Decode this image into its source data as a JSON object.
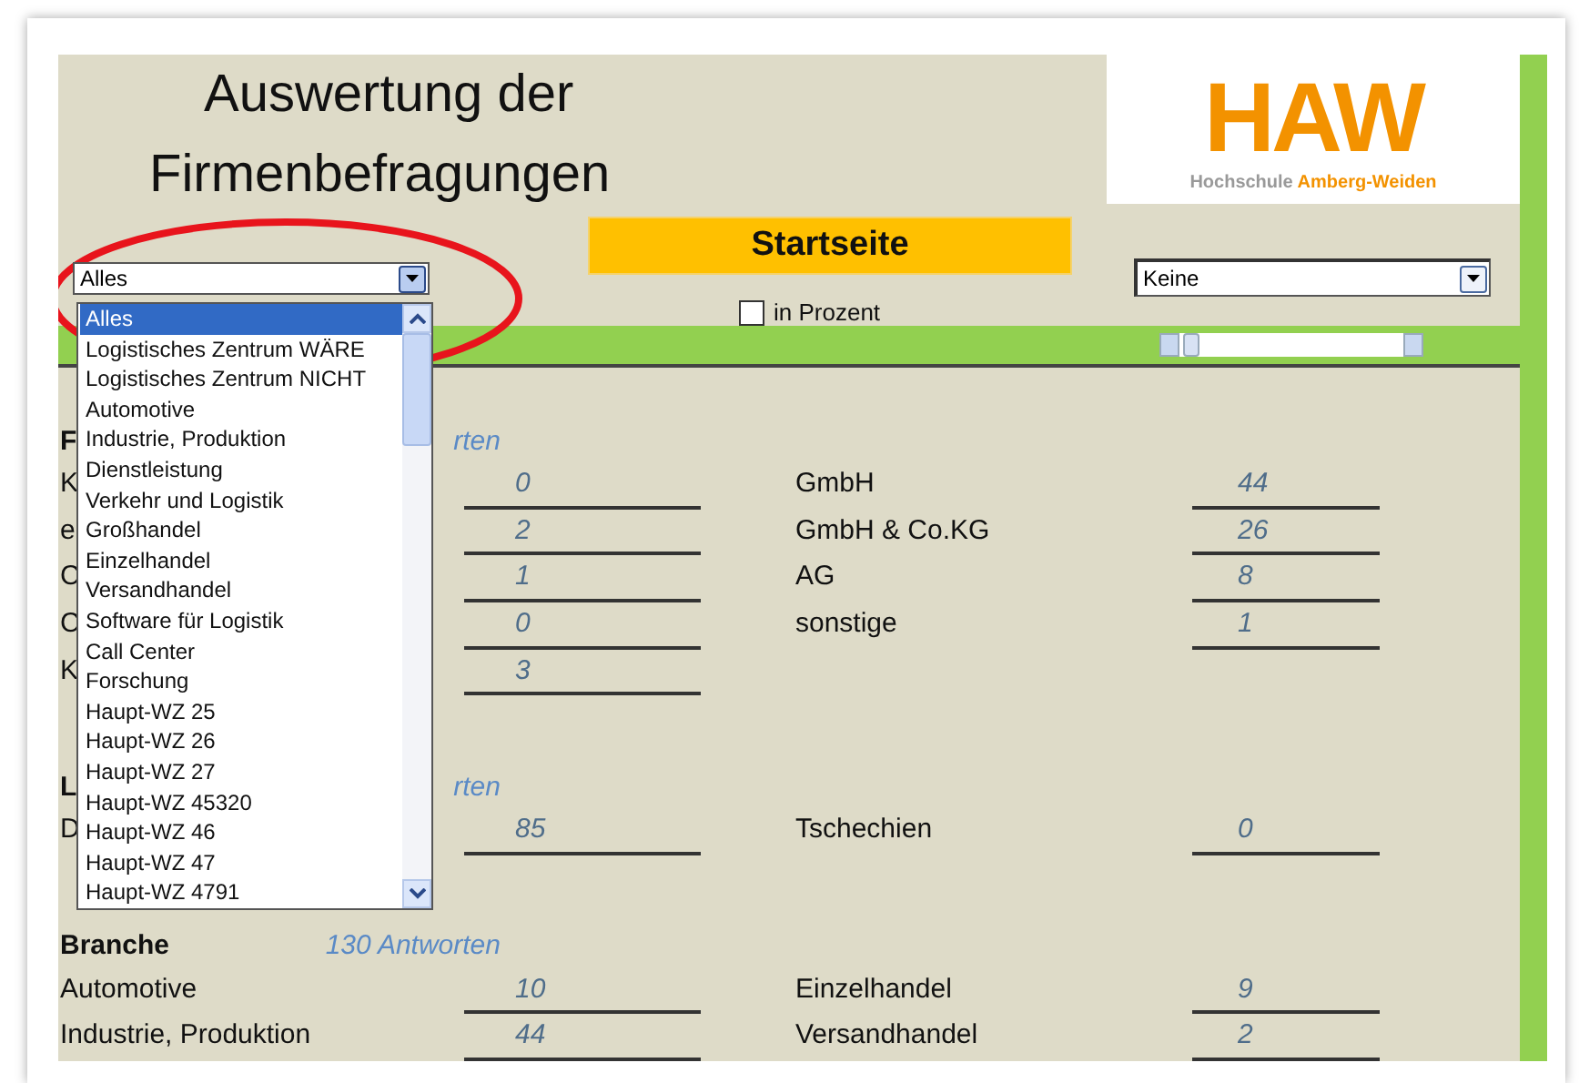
{
  "title_lines": [
    "Auswertung der",
    "Firmenbefragungen"
  ],
  "logo": {
    "wordmark": "HAW",
    "caption": [
      "Hochschule",
      "Amberg-Weiden"
    ]
  },
  "filter_dropdown": {
    "value": "Alles",
    "expanded": true,
    "options": [
      {
        "label": "Alles",
        "selected": true
      },
      {
        "label": "Logistisches Zentrum WÄRE",
        "selected": false
      },
      {
        "label": "Logistisches Zentrum NICHT",
        "selected": false
      },
      {
        "label": "Automotive",
        "selected": false
      },
      {
        "label": "Industrie, Produktion",
        "selected": false
      },
      {
        "label": "Dienstleistung",
        "selected": false
      },
      {
        "label": "Verkehr und Logistik",
        "selected": false
      },
      {
        "label": "Großhandel",
        "selected": false
      },
      {
        "label": "Einzelhandel",
        "selected": false
      },
      {
        "label": "Versandhandel",
        "selected": false
      },
      {
        "label": "Software für Logistik",
        "selected": false
      },
      {
        "label": "Call Center",
        "selected": false
      },
      {
        "label": "Forschung",
        "selected": false
      },
      {
        "label": "Haupt-WZ 25",
        "selected": false
      },
      {
        "label": "Haupt-WZ 26",
        "selected": false
      },
      {
        "label": "Haupt-WZ 27",
        "selected": false
      },
      {
        "label": "Haupt-WZ 45320",
        "selected": false
      },
      {
        "label": "Haupt-WZ 46",
        "selected": false
      },
      {
        "label": "Haupt-WZ 47",
        "selected": false
      },
      {
        "label": "Haupt-WZ 4791",
        "selected": false
      }
    ]
  },
  "start_button": "Startseite",
  "percent_checkbox": {
    "label": "in Prozent",
    "checked": false
  },
  "second_dropdown": {
    "value": "Keine"
  },
  "sections": [
    {
      "heading": "F",
      "count": "rten",
      "rows": [
        {
          "left": {
            "label": "K",
            "value": "0"
          },
          "right": {
            "label": "GmbH",
            "value": "44"
          }
        },
        {
          "left": {
            "label": "e",
            "value": "2"
          },
          "right": {
            "label": "GmbH & Co.KG",
            "value": "26"
          }
        },
        {
          "left": {
            "label": "C",
            "value": "1"
          },
          "right": {
            "label": "AG",
            "value": "8"
          }
        },
        {
          "left": {
            "label": "C",
            "value": "0"
          },
          "right": {
            "label": "sonstige",
            "value": "1"
          }
        },
        {
          "left": {
            "label": "K",
            "value": "3"
          }
        }
      ]
    },
    {
      "heading": "L",
      "count": "rten",
      "rows": [
        {
          "left": {
            "label": "D",
            "value": "85"
          },
          "right": {
            "label": "Tschechien",
            "value": "0"
          }
        }
      ]
    },
    {
      "heading": "Branche",
      "count": "130 Antworten",
      "rows": [
        {
          "left": {
            "label": "Automotive",
            "value": "10"
          },
          "right": {
            "label": "Einzelhandel",
            "value": "9"
          }
        },
        {
          "left": {
            "label": "Industrie, Produktion",
            "value": "44"
          },
          "right": {
            "label": "Versandhandel",
            "value": "2"
          }
        }
      ]
    }
  ]
}
